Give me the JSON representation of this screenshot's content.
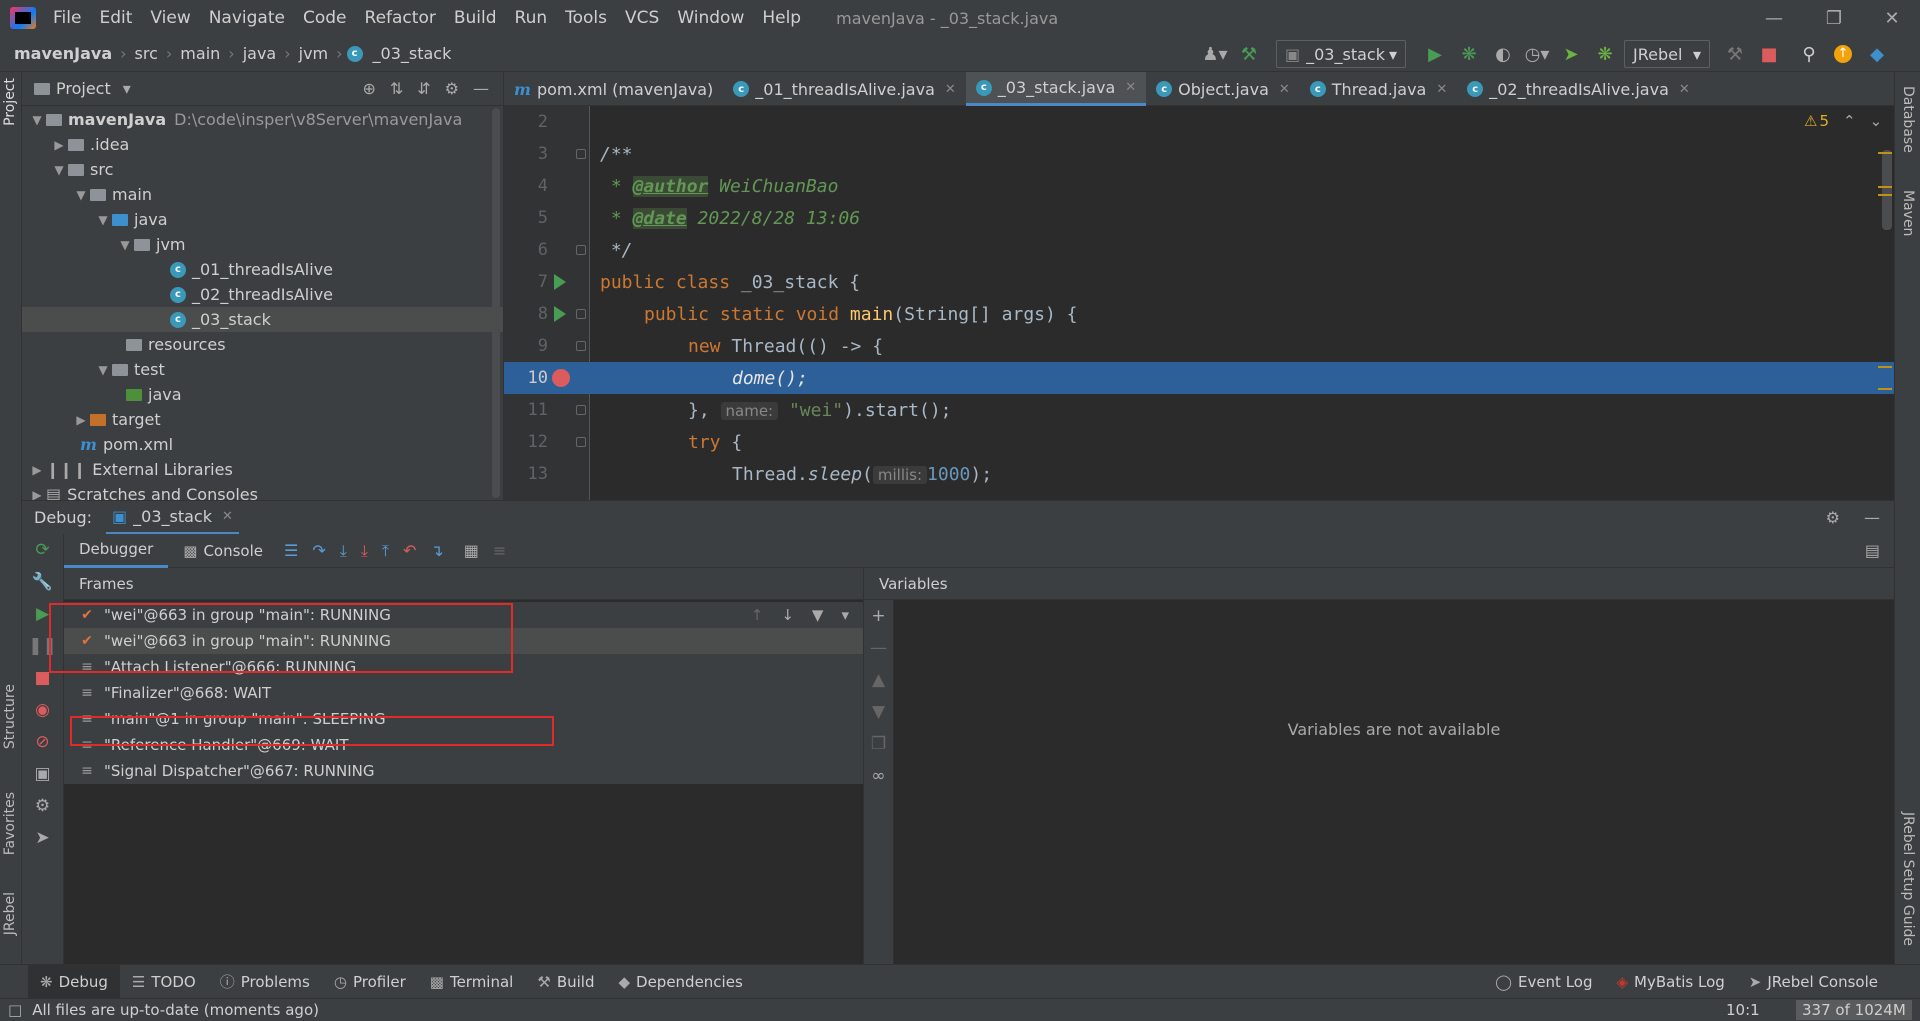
{
  "menu": {
    "items": [
      "File",
      "Edit",
      "View",
      "Navigate",
      "Code",
      "Refactor",
      "Build",
      "Run",
      "Tools",
      "VCS",
      "Window",
      "Help"
    ],
    "window_title": "mavenJava - _03_stack.java"
  },
  "breadcrumb": [
    "mavenJava",
    "src",
    "main",
    "java",
    "jvm",
    "_03_stack"
  ],
  "toolbar": {
    "run_config": "_03_stack",
    "jrebel": "JRebel"
  },
  "project": {
    "header": "Project",
    "root_name": "mavenJava",
    "root_path": "D:\\code\\insper\\v8Server\\mavenJava",
    "items": [
      ".idea",
      "src",
      "main",
      "java",
      "jvm",
      "_01_threadIsAlive",
      "_02_threadIsAlive",
      "_03_stack",
      "resources",
      "test",
      "java",
      "target",
      "pom.xml",
      "External Libraries",
      "Scratches and Consoles"
    ]
  },
  "tabs": [
    "pom.xml (mavenJava)",
    "_01_threadIsAlive.java",
    "_03_stack.java",
    "Object.java",
    "Thread.java",
    "_02_threadIsAlive.java"
  ],
  "editor": {
    "warnings": "5",
    "line_numbers": [
      "2",
      "3",
      "4",
      "5",
      "6",
      "7",
      "8",
      "9",
      "10",
      "11",
      "12",
      "13"
    ],
    "lines": {
      "l3": "/**",
      "l4_star": " * ",
      "l4_tag": "@author",
      "l4_rest": " WeiChuanBao",
      "l5_star": " * ",
      "l5_tag": "@date",
      "l5_rest": " 2022/8/28 13:06",
      "l6": " */",
      "l7_kw": "public class",
      "l7_rest": " _03_stack {",
      "l8_kw": "public static void",
      "l8_fn": "main",
      "l8_rest": "(String[] args) {",
      "l9_kw": "new",
      "l9_rest": " Thread(() -> {",
      "l10": "dome();",
      "l11_a": "}, ",
      "l11_hint": "name:",
      "l11_str": "\"wei\"",
      "l11_b": ").start();",
      "l12_kw": "try",
      "l12_rest": " {",
      "l13_a": "Thread.",
      "l13_fn": "sleep",
      "l13_b": "(",
      "l13_hint": "millis:",
      "l13_num": "1000",
      "l13_c": ");"
    }
  },
  "debug": {
    "label": "Debug:",
    "session": "_03_stack",
    "tabs": [
      "Debugger",
      "Console"
    ],
    "frames_title": "Frames",
    "variables_title": "Variables",
    "variables_empty": "Variables are not available",
    "threads": [
      "\"wei\"@663 in group \"main\": RUNNING",
      "\"wei\"@663 in group \"main\": RUNNING",
      "\"Attach Listener\"@666: RUNNING",
      "\"Finalizer\"@668: WAIT",
      "\"main\"@1 in group \"main\": SLEEPING",
      "\"Reference Handler\"@669: WAIT",
      "\"Signal Dispatcher\"@667: RUNNING"
    ]
  },
  "stripes": {
    "left": [
      "Project",
      "Structure",
      "Favorites",
      "JRebel"
    ],
    "right": [
      "Database",
      "Maven",
      "JRebel Setup Guide"
    ]
  },
  "bottom_tools": [
    "Debug",
    "TODO",
    "Problems",
    "Profiler",
    "Terminal",
    "Build",
    "Dependencies",
    "Event Log",
    "MyBatis Log",
    "JRebel Console"
  ],
  "status": {
    "message": "All files are up-to-date (moments ago)",
    "position": "10:1",
    "memory_used": "337",
    "memory_total": "of 1024M"
  },
  "colors": {
    "accent": "#4a88c7",
    "highlight_line": "#2d6099",
    "annotation_box": "#e02b2b"
  }
}
